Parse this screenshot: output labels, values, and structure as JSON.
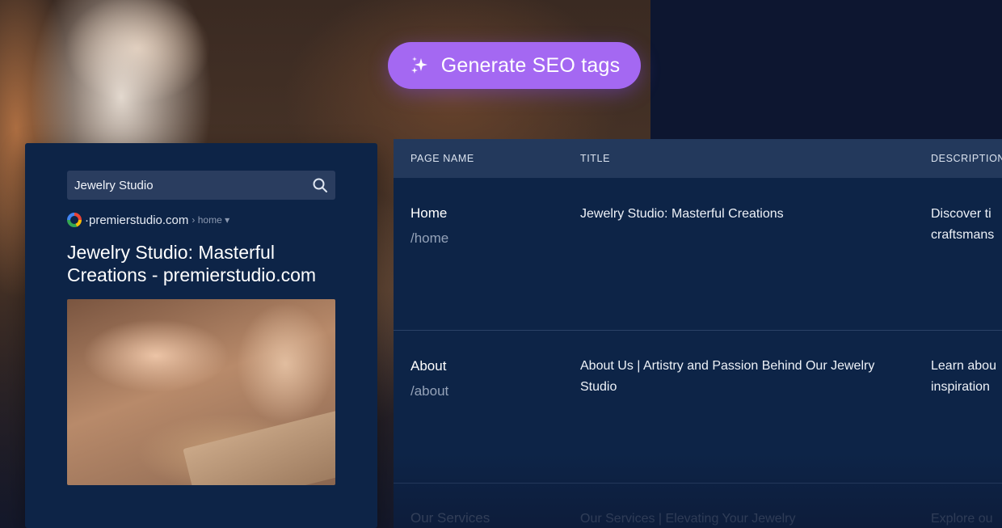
{
  "generate_button": {
    "label": "Generate SEO tags",
    "icon": "sparkle-icon",
    "color": "#a468f2"
  },
  "preview": {
    "search_query": "Jewelry Studio",
    "domain": "premierstudio.com",
    "path": "home",
    "title": "Jewelry Studio: Masterful Creations - premierstudio.com"
  },
  "table": {
    "headers": [
      "PAGE NAME",
      "TITLE",
      "DESCRIPTION"
    ],
    "rows": [
      {
        "name": "Home",
        "path": "/home",
        "title": "Jewelry Studio: Masterful Creations",
        "description": [
          "Discover ti",
          "craftsmans"
        ]
      },
      {
        "name": "About",
        "path": "/about",
        "title": "About Us | Artistry and Passion Behind Our Jewelry Studio",
        "description": [
          "Learn abou",
          "inspiration"
        ]
      },
      {
        "name": "Our Services",
        "path": "",
        "title": "Our Services | Elevating Your Jewelry",
        "description": [
          "Explore ou"
        ]
      }
    ]
  }
}
